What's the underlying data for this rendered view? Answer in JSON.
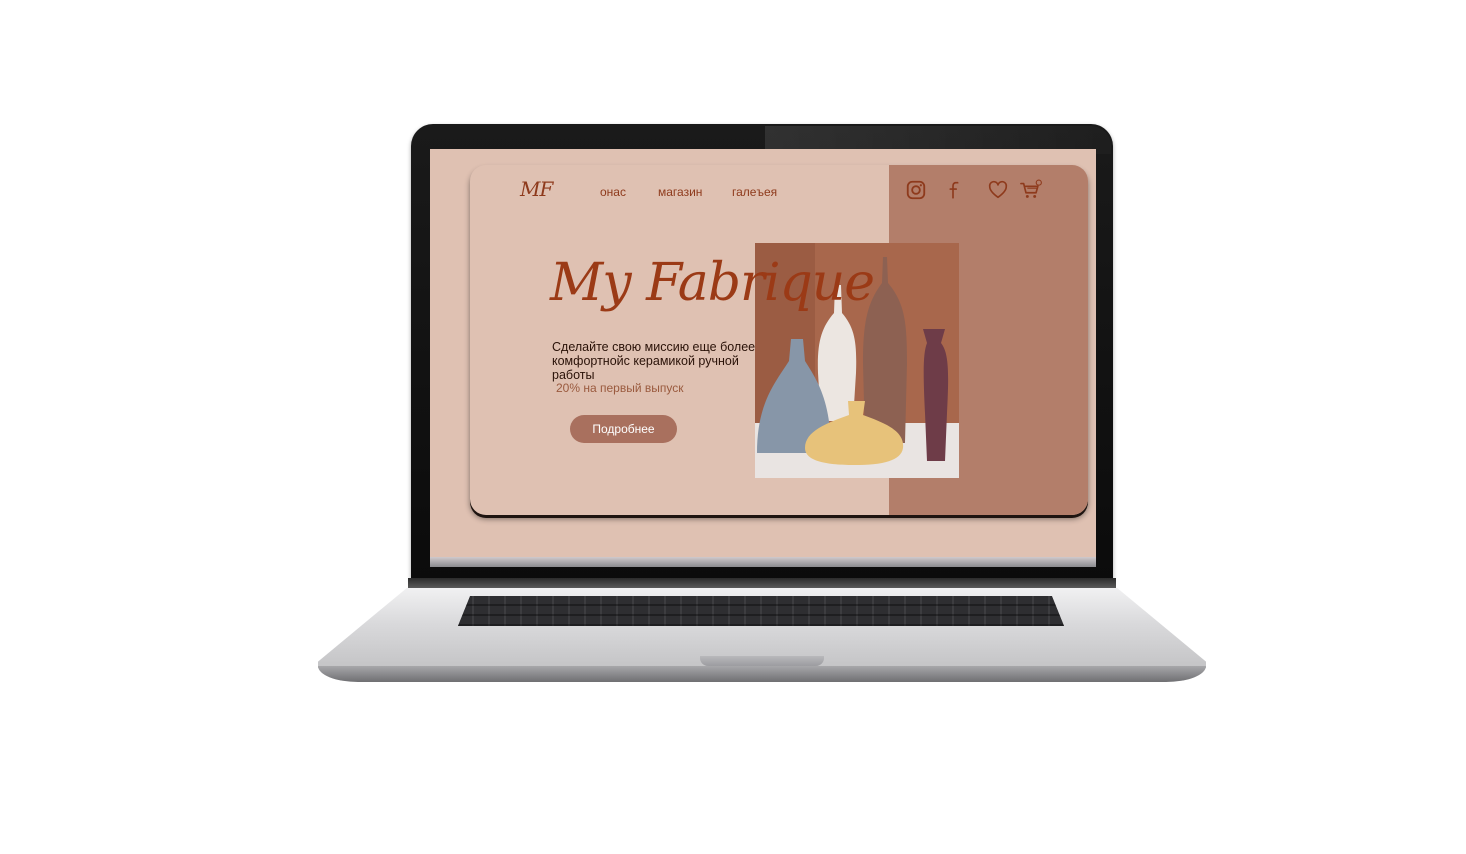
{
  "site": {
    "logo": "MF",
    "nav": [
      {
        "label": "онас"
      },
      {
        "label": "магазин"
      },
      {
        "label": "галеъея"
      }
    ],
    "icons": [
      "instagram-icon",
      "facebook-icon",
      "heart-icon",
      "cart-icon"
    ]
  },
  "hero": {
    "title": "My Fabrique",
    "subtitle": "Сделайте свою миссию еще более комфортнойс керамикой ручной работы",
    "promo": "20% на первый выпуск",
    "button_label": "Подробнее"
  },
  "colors": {
    "background": "#dfc1b2",
    "accent_panel": "#b37e6a",
    "brand_text": "#8e3a1c",
    "button": "#a9705e"
  }
}
